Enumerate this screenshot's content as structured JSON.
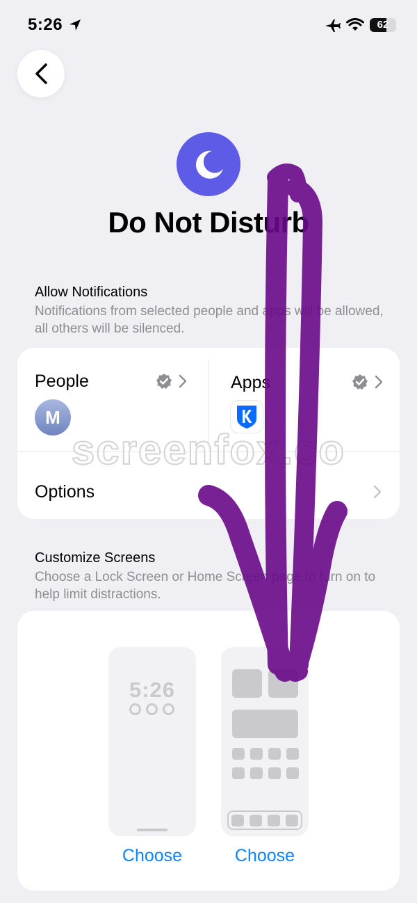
{
  "status_bar": {
    "time": "5:26",
    "battery": "62",
    "battery_level": 0.62
  },
  "header": {
    "title": "Do Not Disturb"
  },
  "allow_notifications": {
    "title": "Allow Notifications",
    "description": "Notifications from selected people and apps will be allowed, all others will be silenced.",
    "people_label": "People",
    "people_avatar_initial": "M",
    "apps_label": "Apps",
    "options_label": "Options"
  },
  "customize_screens": {
    "title": "Customize Screens",
    "description": "Choose a Lock Screen or Home Screen page to turn on to help limit distractions.",
    "lock_preview_time": "5:26",
    "lock_choose_label": "Choose",
    "home_choose_label": "Choose"
  },
  "watermark": "screenfox.co",
  "colors": {
    "accent": "#0a84ff",
    "focus": "#5e5ce6",
    "arrow": "#6a0a8a"
  }
}
